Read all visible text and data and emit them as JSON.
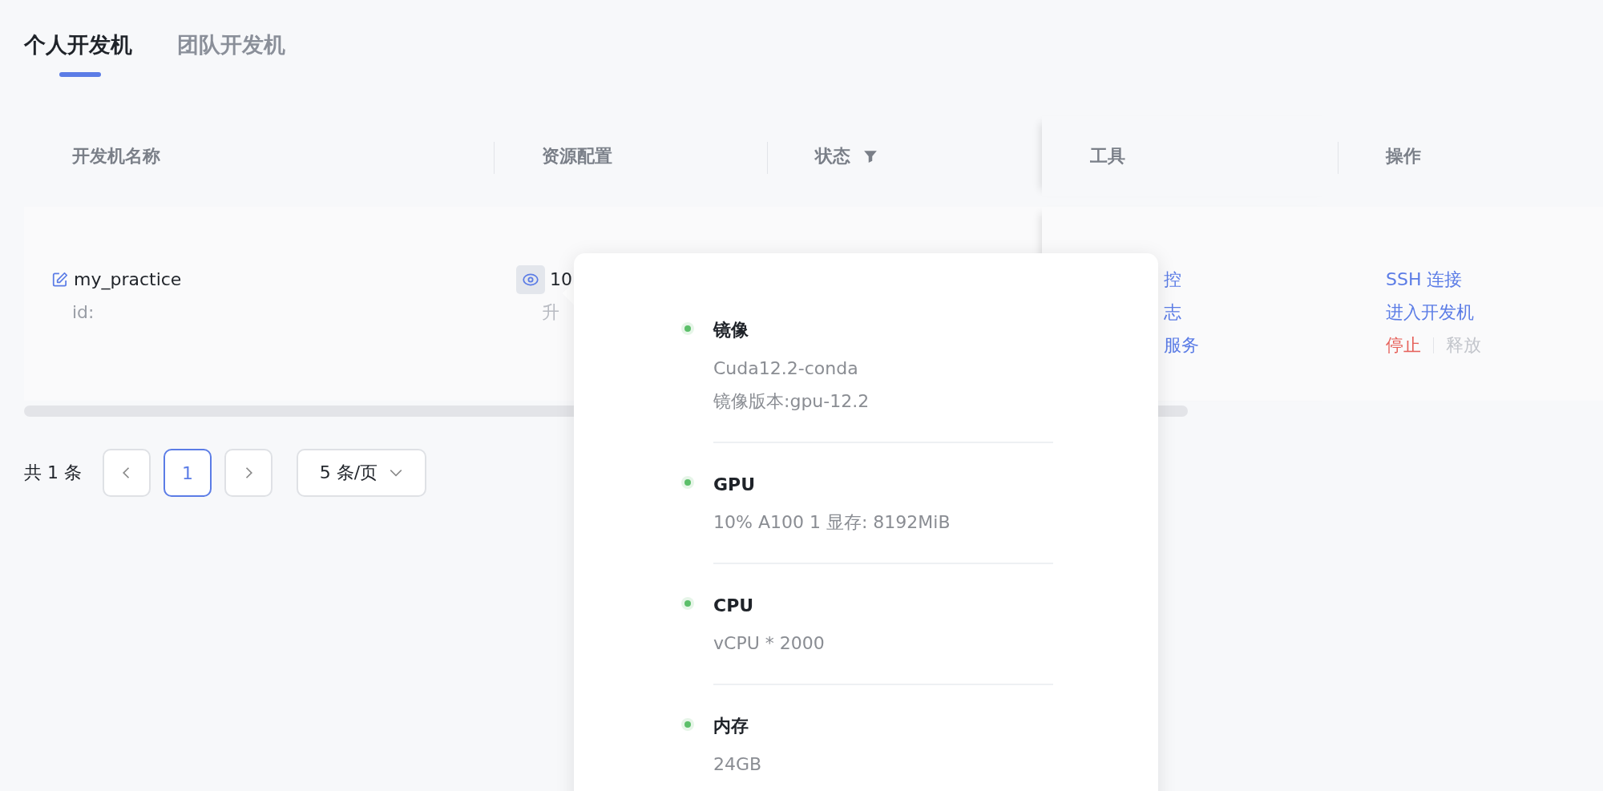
{
  "tabs": [
    {
      "label": "个人开发机",
      "selected": true
    },
    {
      "label": "团队开发机",
      "selected": false
    }
  ],
  "table": {
    "columns": [
      {
        "label": "开发机名称",
        "kind": "plain"
      },
      {
        "label": "资源配置",
        "kind": "plain"
      },
      {
        "label": "状态",
        "kind": "filterable"
      },
      {
        "label": "工具",
        "kind": "plain"
      },
      {
        "label": "操作",
        "kind": "plain"
      }
    ],
    "rows": [
      {
        "name": "my_practice",
        "id_label": "id:",
        "resource": {
          "value": "10",
          "sub": "升"
        },
        "tools": [
          "控",
          "志",
          "服务"
        ],
        "actions": [
          [
            {
              "label": "SSH 连接",
              "kind": "link"
            }
          ],
          [
            {
              "label": "进入开发机",
              "kind": "link"
            }
          ],
          [
            {
              "label": "停止",
              "kind": "danger"
            },
            {
              "label": "释放",
              "kind": "disabled"
            }
          ]
        ]
      }
    ]
  },
  "pagination": {
    "total": "共 1 条",
    "pages": [
      {
        "label": "1",
        "selected": true
      }
    ],
    "page_size": "5 条/页"
  },
  "popover": {
    "items": [
      {
        "title": "镜像",
        "lines": [
          "Cuda12.2-conda",
          "镜像版本:gpu-12.2"
        ]
      },
      {
        "title": "GPU",
        "lines": [
          "10% A100 1 显存: 8192MiB"
        ]
      },
      {
        "title": "CPU",
        "lines": [
          "vCPU * 2000"
        ]
      },
      {
        "title": "内存",
        "lines": [
          "24GB"
        ]
      }
    ]
  }
}
